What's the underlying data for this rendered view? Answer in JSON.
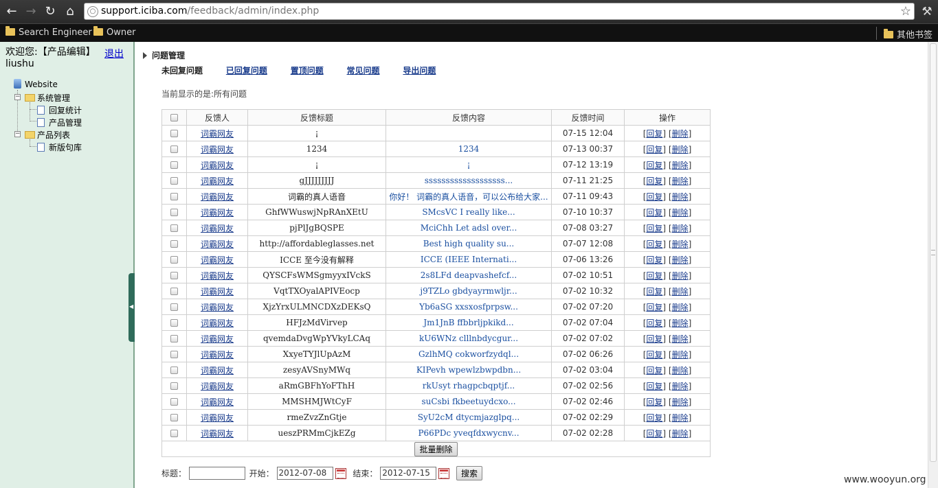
{
  "browser": {
    "url_host": "support.iciba.com",
    "url_path": "/feedback/admin/index.php",
    "bookmarks": [
      "Search Engineer",
      "Owner"
    ],
    "other_bookmarks": "其他书签"
  },
  "sidebar": {
    "welcome": "欢迎您:【产品编辑】",
    "logout": "退出",
    "username": "liushu",
    "tree": {
      "root": "Website",
      "groups": [
        {
          "label": "系统管理",
          "items": [
            "回复统计",
            "产品管理"
          ]
        },
        {
          "label": "产品列表",
          "items": [
            "新版句库"
          ]
        }
      ]
    }
  },
  "main": {
    "section_title": "问题管理",
    "tabs": [
      "未回复问题",
      "已回复问题",
      "置顶问题",
      "常见问题",
      "导出问题"
    ],
    "current_view": "当前显示的是:所有问题",
    "table": {
      "headers": [
        "反馈人",
        "反馈标题",
        "反馈内容",
        "反馈时间",
        "操作"
      ],
      "reply_label": "回复",
      "delete_label": "删除",
      "rows": [
        {
          "user": "词霸网友",
          "title": "¡",
          "content": "",
          "time": "07-15 12:04"
        },
        {
          "user": "词霸网友",
          "title": "1234",
          "content": "1234",
          "time": "07-13 00:37"
        },
        {
          "user": "词霸网友",
          "title": "¡",
          "content": "¡",
          "time": "07-12 13:19"
        },
        {
          "user": "词霸网友",
          "title": "gJJJJJJJJJ",
          "content": "sssssssssssssssssss...",
          "time": "07-11 21:25"
        },
        {
          "user": "词霸网友",
          "title": "词霸的真人语音",
          "content": "你好！ 词霸的真人语音，可以公布给大家...",
          "time": "07-11 09:43"
        },
        {
          "user": "词霸网友",
          "title": "GhfWWuswjNpRAnXEtU",
          "content": "SMcsVC I really like...",
          "time": "07-10 10:37"
        },
        {
          "user": "词霸网友",
          "title": "pjPlJgBQSPE",
          "content": "MciChh Let adsl over...",
          "time": "07-08 03:27"
        },
        {
          "user": "词霸网友",
          "title": "http://affordableglasses.net",
          "content": "Best high quality su...",
          "time": "07-07 12:08"
        },
        {
          "user": "词霸网友",
          "title": "ICCE 至今没有解释",
          "content": "ICCE (IEEE Internati...",
          "time": "07-06 13:26"
        },
        {
          "user": "词霸网友",
          "title": "QYSCFsWMSgmyyxIVckS",
          "content": "2s8LFd deapvashefcf...",
          "time": "07-02 10:51"
        },
        {
          "user": "词霸网友",
          "title": "VqtTXOyalAPIVEocp",
          "content": "j9TZLo gbdyayrmwljr...",
          "time": "07-02 10:32"
        },
        {
          "user": "词霸网友",
          "title": "XjzYrxULMNCDXzDEKsQ",
          "content": "Yb6aSG xxsxosfprpsw...",
          "time": "07-02 07:20"
        },
        {
          "user": "词霸网友",
          "title": "HFJzMdVirvep",
          "content": "Jm1JnB ffbbrljpkikd...",
          "time": "07-02 07:04"
        },
        {
          "user": "词霸网友",
          "title": "qvemdaDvgWpYVkyLCAq",
          "content": "kU6WNz clllnbdycgur...",
          "time": "07-02 07:02"
        },
        {
          "user": "词霸网友",
          "title": "XxyeTYJlUpAzM",
          "content": "GzlhMQ cokworfzydql...",
          "time": "07-02 06:26"
        },
        {
          "user": "词霸网友",
          "title": "zesyAVSnyMWq",
          "content": "KIPevh wpewlzbwpdbn...",
          "time": "07-02 03:04"
        },
        {
          "user": "词霸网友",
          "title": "aRmGBFhYoFThH",
          "content": "rkUsyt rhagpcbqptjf...",
          "time": "07-02 02:56"
        },
        {
          "user": "词霸网友",
          "title": "MMSHMJWtCyF",
          "content": "suCsbi fkbeetuydcxo...",
          "time": "07-02 02:46"
        },
        {
          "user": "词霸网友",
          "title": "rmeZvzZnGtje",
          "content": "SyU2cM dtycmjazglpq...",
          "time": "07-02 02:29"
        },
        {
          "user": "词霸网友",
          "title": "ueszPRMmCjkEZg",
          "content": "P66PDc yveqfdxwycnv...",
          "time": "07-02 02:28"
        }
      ],
      "batch_delete": "批量删除"
    },
    "search": {
      "title_label": "标题：",
      "title_value": "",
      "start_label": "开始：",
      "start_value": "2012-07-08",
      "end_label": "结束：",
      "end_value": "2012-07-15",
      "button": "搜索"
    }
  },
  "watermark": "www.wooyun.org"
}
